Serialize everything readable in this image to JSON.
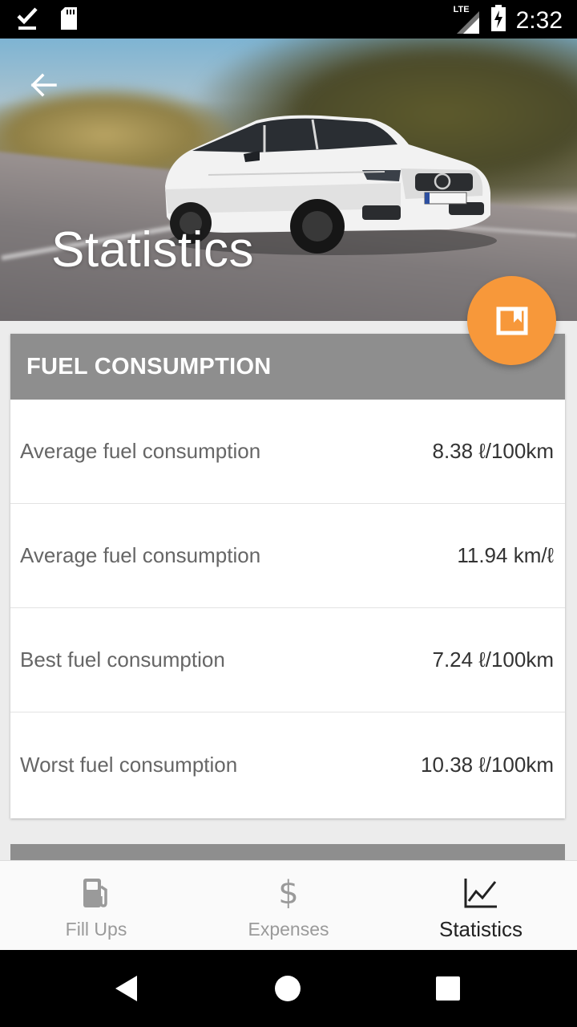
{
  "status_bar": {
    "network": "LTE",
    "time": "2:32"
  },
  "header": {
    "title": "Statistics"
  },
  "fuel_card": {
    "title": "FUEL CONSUMPTION",
    "rows": [
      {
        "label": "Average fuel consumption",
        "value": "8.38 ℓ/100km"
      },
      {
        "label": "Average fuel consumption",
        "value": "11.94 km/ℓ"
      },
      {
        "label": "Best fuel consumption",
        "value": "7.24 ℓ/100km"
      },
      {
        "label": "Worst fuel consumption",
        "value": "10.38 ℓ/100km"
      }
    ]
  },
  "bottom_nav": {
    "items": [
      {
        "label": "Fill Ups",
        "icon": "fuel-pump-icon"
      },
      {
        "label": "Expenses",
        "icon": "dollar-icon",
        "glyph": "$"
      },
      {
        "label": "Statistics",
        "icon": "line-chart-icon",
        "active": true
      }
    ]
  },
  "colors": {
    "accent": "#f7983a",
    "card_header": "#8e8e8e",
    "status_bar": "#000000"
  }
}
